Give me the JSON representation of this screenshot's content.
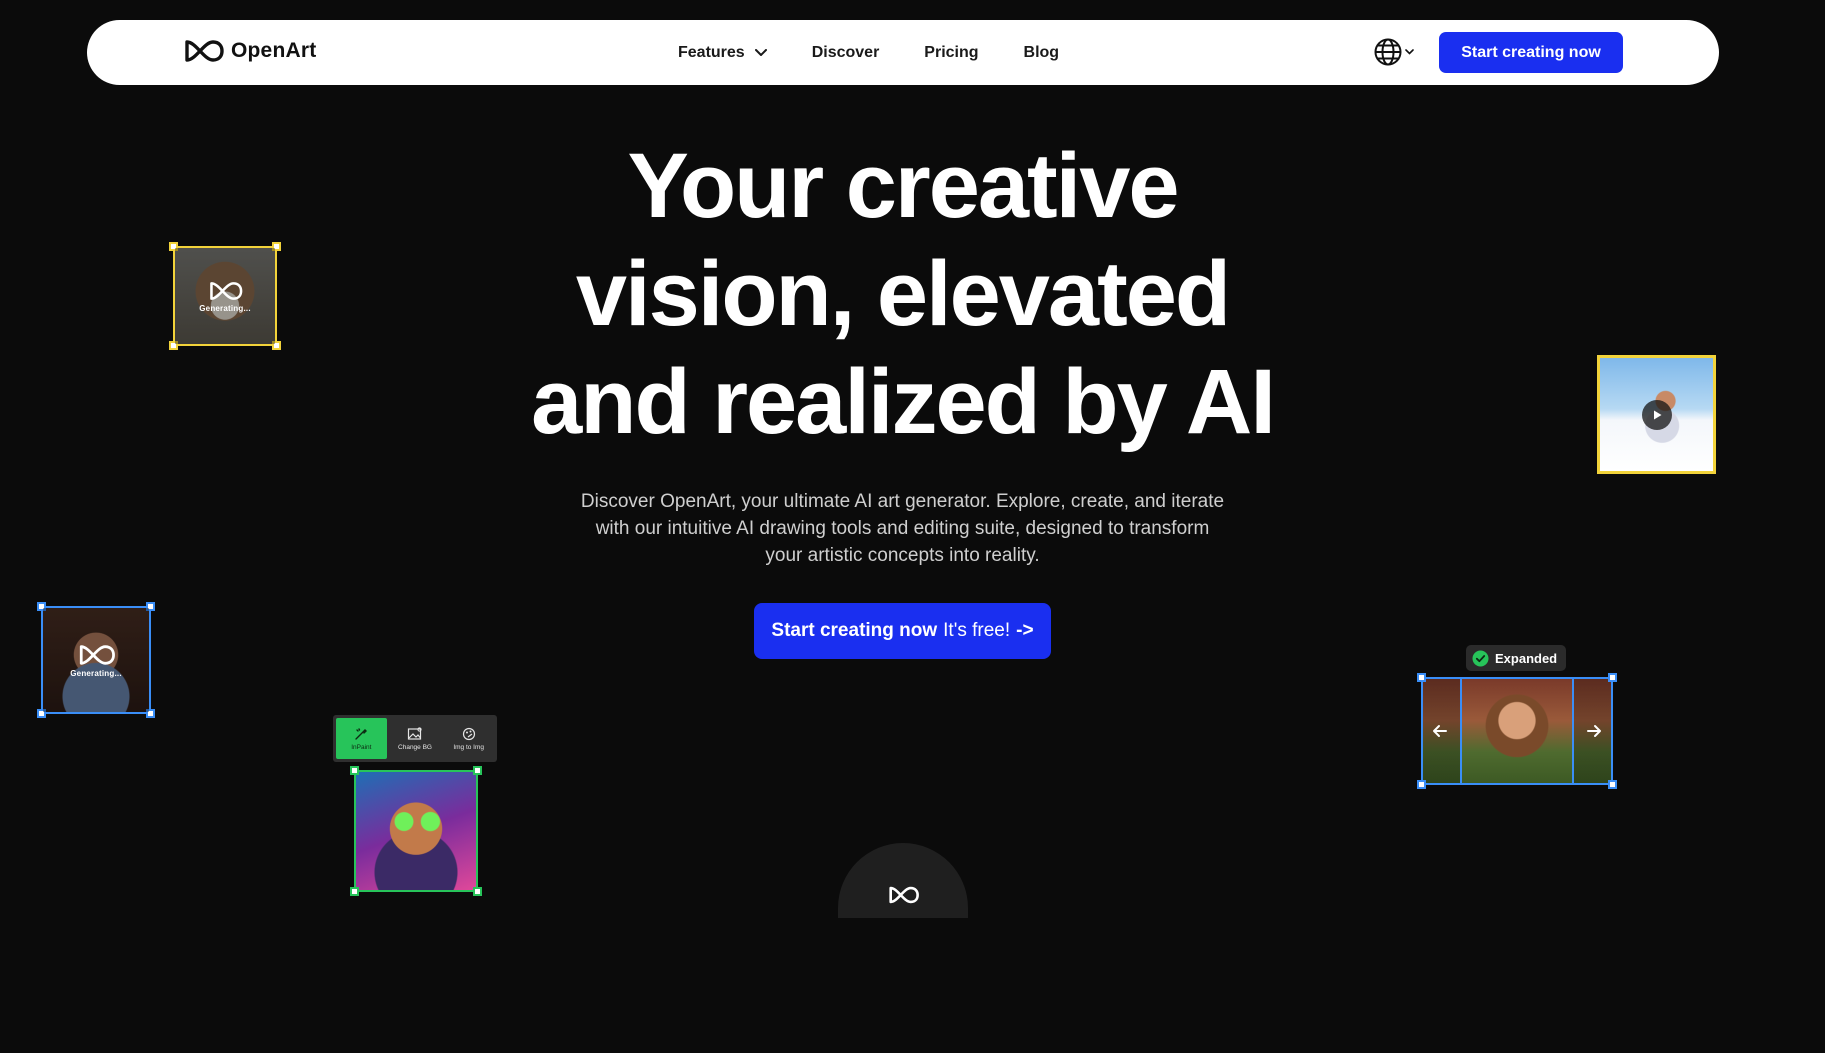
{
  "nav": {
    "logo_text": "OpenArt",
    "links": [
      {
        "label": "Features"
      },
      {
        "label": "Discover"
      },
      {
        "label": "Pricing"
      },
      {
        "label": "Blog"
      }
    ],
    "cta_label": "Start creating now"
  },
  "hero": {
    "title_lines": [
      "Your creative",
      "vision, elevated",
      "and realized by AI"
    ],
    "subtitle": "Discover OpenArt, your ultimate AI art generator. Explore, create, and iterate with our intuitive AI drawing tools and editing suite, designed to transform your artistic concepts into reality.",
    "cta_bold": "Start creating now",
    "cta_light": "It's free!",
    "cta_arrow": "->"
  },
  "cards": {
    "generating_label": "Generating...",
    "toolbar": [
      {
        "label": "InPaint"
      },
      {
        "label": "Change BG"
      },
      {
        "label": "Img to Img"
      }
    ],
    "expanded_label": "Expanded"
  },
  "colors": {
    "accent": "#1a2ff0",
    "yellow": "#f2d33a",
    "blue": "#3a8ef7",
    "green": "#27c45a"
  }
}
